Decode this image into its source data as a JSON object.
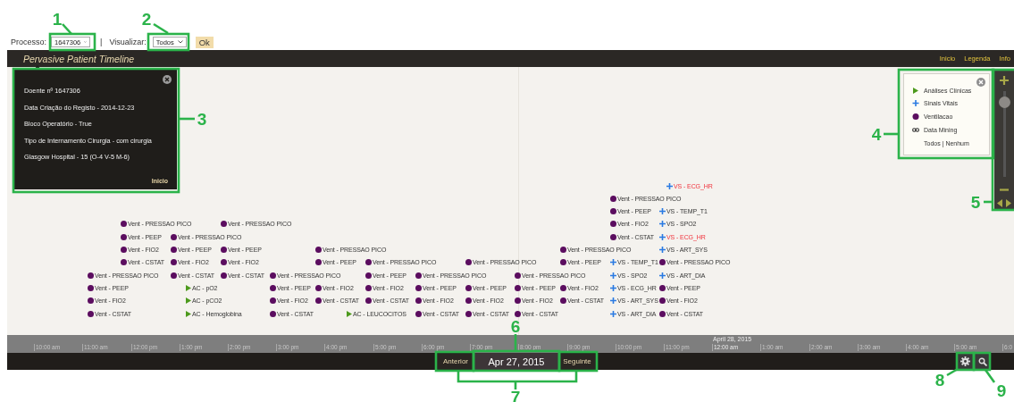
{
  "toolbar": {
    "process_label": "Processo:",
    "process_value": "1647306",
    "separator": "|",
    "view_label": "Visualizar:",
    "view_value": "Todos",
    "ok_button": "Ok"
  },
  "timeline": {
    "title": "Pervasive Patient Timeline",
    "nav_links": [
      "Inicio",
      "Legenda",
      "Info"
    ],
    "info_popup": {
      "lines": [
        "Doente nº 1647306",
        "Data Criação do Registo - 2014-12-23",
        "Bloco Operatório - True",
        "Tipo de Internamento Cirurgia - com cirurgia",
        "Glasgow Hospital - 15 (O-4 V-5 M-6)"
      ],
      "link": "Inicio"
    },
    "legend": {
      "items": [
        {
          "kind": "ac",
          "label": "Análises Clínicas"
        },
        {
          "kind": "vs",
          "label": "Sinais Vitais"
        },
        {
          "kind": "vent",
          "label": "Ventilacao"
        },
        {
          "kind": "dm",
          "label": "Data Mining"
        }
      ],
      "filter": "Todos | Nenhum"
    },
    "zoom": {
      "level": 0.92
    },
    "event_columns": [
      {
        "events": [
          {
            "kind": "vent",
            "label": "Vent - PRESSAO PICO",
            "alert": false
          },
          {
            "kind": "vent",
            "label": "Vent - PEEP",
            "alert": false
          },
          {
            "kind": "vent",
            "label": "Vent - FIO2",
            "alert": false
          },
          {
            "kind": "vent",
            "label": "Vent - CSTAT",
            "alert": false
          }
        ]
      },
      {
        "events": [
          {
            "kind": "vent",
            "label": "Vent - PRESSAO PICO",
            "alert": false
          },
          {
            "kind": "vent",
            "label": "Vent - PEEP",
            "alert": false
          },
          {
            "kind": "vent",
            "label": "Vent - FIO2",
            "alert": false
          },
          {
            "kind": "vent",
            "label": "Vent - CSTAT",
            "alert": false
          }
        ]
      },
      {
        "events": [
          {
            "kind": "vent",
            "label": "Vent - PRESSAO PICO",
            "alert": false
          },
          {
            "kind": "vent",
            "label": "Vent - PEEP",
            "alert": false
          },
          {
            "kind": "vent",
            "label": "Vent - FIO2",
            "alert": false
          },
          {
            "kind": "vent",
            "label": "Vent - CSTAT",
            "alert": false
          }
        ]
      },
      {
        "events": [
          {
            "kind": "ac",
            "label": "AC - pO2",
            "alert": false
          },
          {
            "kind": "ac",
            "label": "AC - pCO2",
            "alert": false
          },
          {
            "kind": "ac",
            "label": "AC - Hemoglobina",
            "alert": false
          }
        ]
      },
      {
        "events": [
          {
            "kind": "vent",
            "label": "Vent - PRESSAO PICO",
            "alert": false
          }
        ]
      },
      {
        "events": [
          {
            "kind": "vent",
            "label": "Vent - PEEP",
            "alert": false
          },
          {
            "kind": "vent",
            "label": "Vent - FIO2",
            "alert": false
          },
          {
            "kind": "vent",
            "label": "Vent - CSTAT",
            "alert": false
          }
        ]
      },
      {
        "events": [
          {
            "kind": "vent",
            "label": "Vent - PRESSAO PICO",
            "alert": false
          },
          {
            "kind": "vent",
            "label": "Vent - PEEP",
            "alert": false
          },
          {
            "kind": "vent",
            "label": "Vent - FIO2",
            "alert": false
          },
          {
            "kind": "vent",
            "label": "Vent - CSTAT",
            "alert": false
          }
        ]
      },
      {
        "events": [
          {
            "kind": "vent",
            "label": "Vent - PRESSAO PICO",
            "alert": false
          },
          {
            "kind": "vent",
            "label": "Vent - PEEP",
            "alert": false
          }
        ]
      },
      {
        "events": [
          {
            "kind": "vent",
            "label": "Vent - FIO2",
            "alert": false
          },
          {
            "kind": "vent",
            "label": "Vent - CSTAT",
            "alert": false
          }
        ]
      },
      {
        "events": [
          {
            "kind": "ac",
            "label": "AC - LEUCOCITOS",
            "alert": false
          }
        ]
      },
      {
        "events": [
          {
            "kind": "vent",
            "label": "Vent - PRESSAO PICO",
            "alert": false
          },
          {
            "kind": "vent",
            "label": "Vent - PEEP",
            "alert": false
          },
          {
            "kind": "vent",
            "label": "Vent - FIO2",
            "alert": false
          },
          {
            "kind": "vent",
            "label": "Vent - CSTAT",
            "alert": false
          }
        ]
      },
      {
        "events": [
          {
            "kind": "vent",
            "label": "Vent - PRESSAO PICO",
            "alert": false
          },
          {
            "kind": "vent",
            "label": "Vent - PEEP",
            "alert": false
          },
          {
            "kind": "vent",
            "label": "Vent - FIO2",
            "alert": false
          },
          {
            "kind": "vent",
            "label": "Vent - CSTAT",
            "alert": false
          }
        ]
      },
      {
        "events": [
          {
            "kind": "vent",
            "label": "Vent - PRESSAO PICO",
            "alert": false
          }
        ]
      },
      {
        "events": [
          {
            "kind": "vent",
            "label": "Vent - PEEP",
            "alert": false
          },
          {
            "kind": "vent",
            "label": "Vent - FIO2",
            "alert": false
          },
          {
            "kind": "vent",
            "label": "Vent - CSTAT",
            "alert": false
          }
        ]
      },
      {
        "events": [
          {
            "kind": "vent",
            "label": "Vent - PRESSAO PICO",
            "alert": false
          },
          {
            "kind": "vent",
            "label": "Vent - PEEP",
            "alert": false
          },
          {
            "kind": "vent",
            "label": "Vent - FIO2",
            "alert": false
          },
          {
            "kind": "vent",
            "label": "Vent - CSTAT",
            "alert": false
          }
        ]
      },
      {
        "events": [
          {
            "kind": "vent",
            "label": "Vent - PRESSAO PICO",
            "alert": false
          },
          {
            "kind": "vent",
            "label": "Vent - PEEP",
            "alert": false
          }
        ]
      },
      {
        "events": [
          {
            "kind": "vent",
            "label": "Vent - FIO2",
            "alert": false
          },
          {
            "kind": "vent",
            "label": "Vent - CSTAT",
            "alert": false
          }
        ]
      },
      {
        "events": [
          {
            "kind": "vent",
            "label": "Vent - PRESSAO PICO",
            "alert": false
          },
          {
            "kind": "vent",
            "label": "Vent - PEEP",
            "alert": false
          },
          {
            "kind": "vent",
            "label": "Vent - FIO2",
            "alert": false
          },
          {
            "kind": "vent",
            "label": "Vent - CSTAT",
            "alert": false
          }
        ]
      },
      {
        "events": [
          {
            "kind": "vs",
            "label": "VS - TEMP_T1",
            "alert": false
          },
          {
            "kind": "vs",
            "label": "VS - SPO2",
            "alert": false
          },
          {
            "kind": "vs",
            "label": "VS - ECG_HR",
            "alert": false
          },
          {
            "kind": "vs",
            "label": "VS - ART_SYS",
            "alert": false
          },
          {
            "kind": "vs",
            "label": "VS - ART_DIA",
            "alert": false
          }
        ]
      },
      {
        "events": [
          {
            "kind": "vs",
            "label": "VS - ECG_HR",
            "alert": true
          }
        ]
      },
      {
        "events": [
          {
            "kind": "vs",
            "label": "VS - TEMP_T1",
            "alert": false
          },
          {
            "kind": "vs",
            "label": "VS - SPO2",
            "alert": false
          },
          {
            "kind": "vs",
            "label": "VS - ECG_HR",
            "alert": true
          },
          {
            "kind": "vs",
            "label": "VS - ART_SYS",
            "alert": false
          },
          {
            "kind": "vent",
            "label": "Vent - PRESSAO PICO",
            "alert": false
          },
          {
            "kind": "vs",
            "label": "VS - ART_DIA",
            "alert": false
          },
          {
            "kind": "vent",
            "label": "Vent - PEEP",
            "alert": false
          },
          {
            "kind": "vent",
            "label": "Vent - FIO2",
            "alert": false
          },
          {
            "kind": "vent",
            "label": "Vent - CSTAT",
            "alert": false
          }
        ]
      }
    ],
    "axis": {
      "date_label": "April 28, 2015",
      "ticks": [
        "10:00 am",
        "11:00 am",
        "12:00 pm",
        "1:00 pm",
        "2:00 pm",
        "3:00 pm",
        "4:00 pm",
        "5:00 pm",
        "6:00 pm",
        "7:00 pm",
        "8:00 pm",
        "9:00 pm",
        "10:00 pm",
        "11:00 pm",
        "12:00 am",
        "1:00 am",
        "2:00 am",
        "3:00 am",
        "4:00 am",
        "5:00 am",
        "6:0"
      ]
    },
    "footer": {
      "previous": "Anterior",
      "date": "Apr 27, 2015",
      "next": "Seguinte"
    }
  },
  "annotations": [
    {
      "label": "1"
    },
    {
      "label": "2"
    },
    {
      "label": "3"
    },
    {
      "label": "4"
    },
    {
      "label": "5"
    },
    {
      "label": "6"
    },
    {
      "label": "7"
    },
    {
      "label": "8"
    },
    {
      "label": "9"
    }
  ]
}
